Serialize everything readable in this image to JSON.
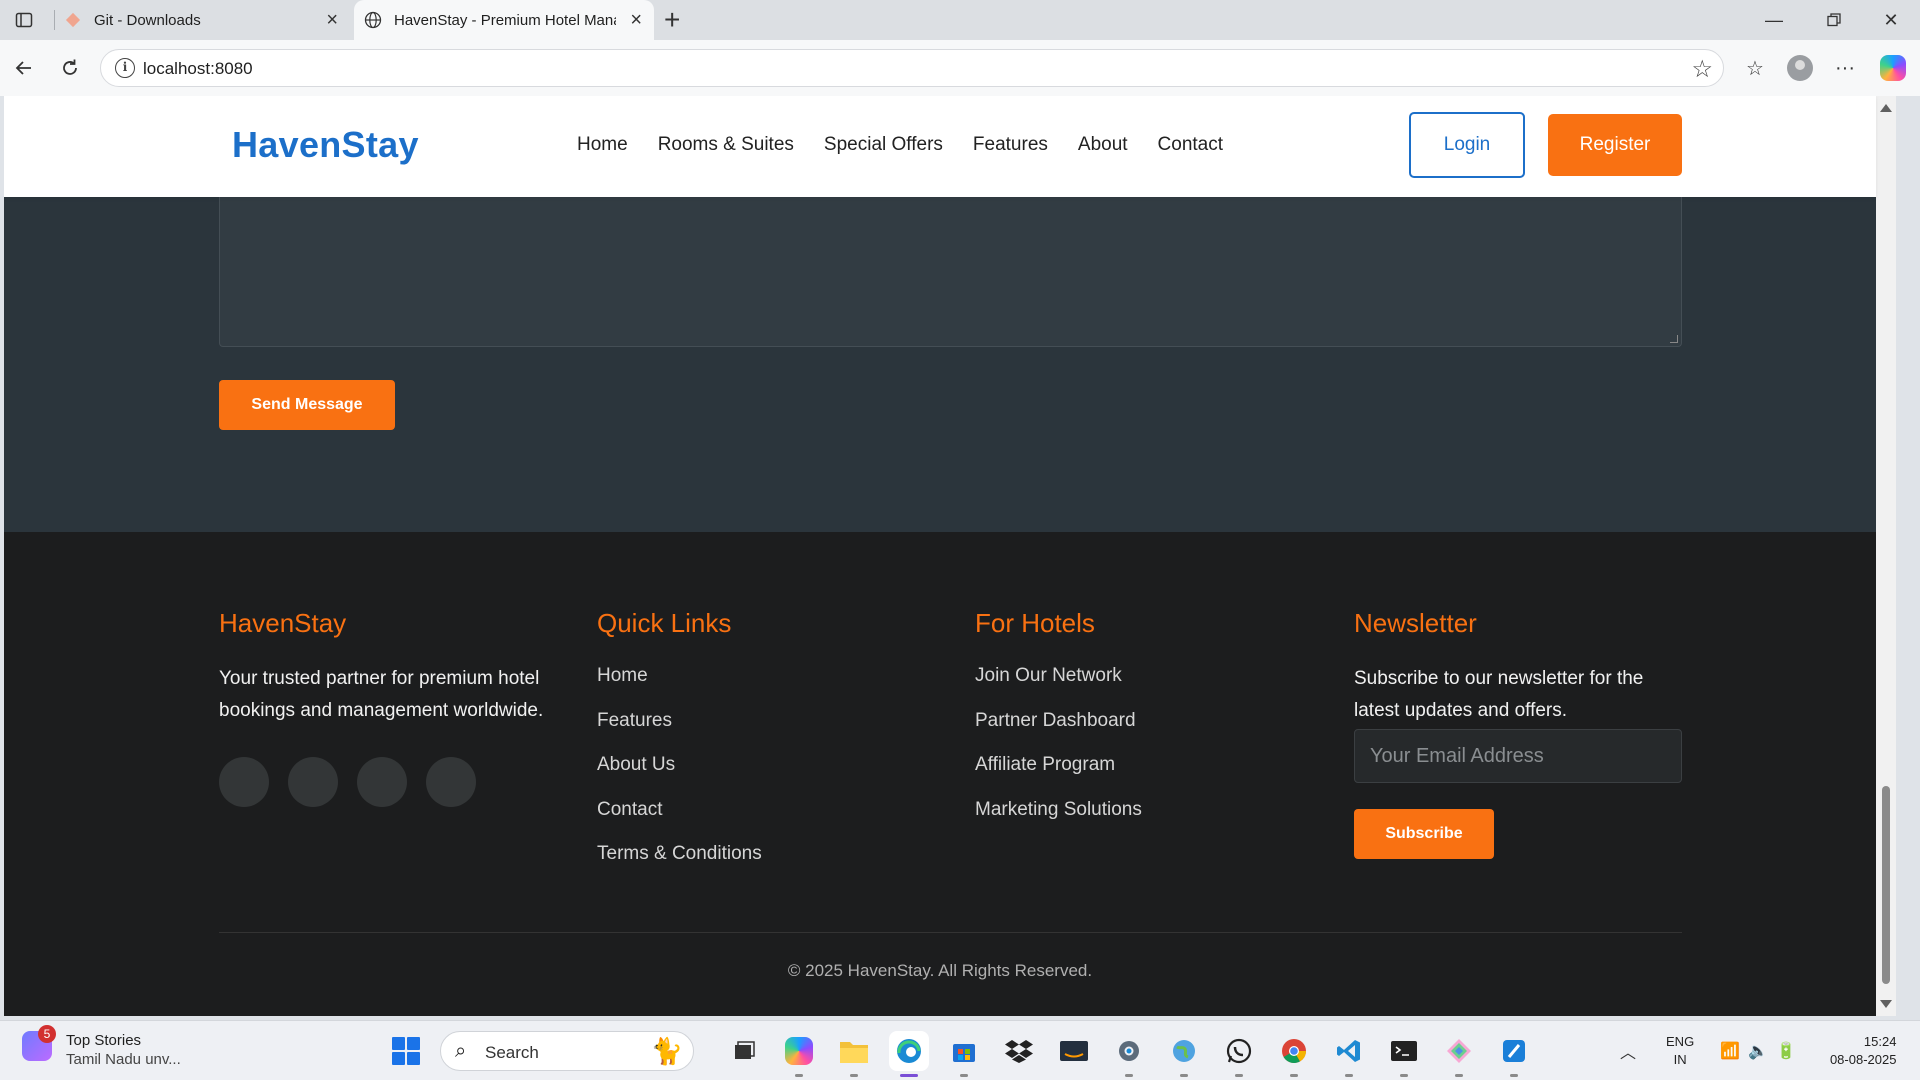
{
  "browser": {
    "tabs": [
      {
        "title": "Git - Downloads",
        "favicon": "git-icon",
        "active": false
      },
      {
        "title": "HavenStay - Premium Hotel Mana",
        "favicon": "globe-icon",
        "active": true
      }
    ],
    "url": "localhost:8080"
  },
  "site": {
    "logo": "HavenStay",
    "nav": [
      "Home",
      "Rooms & Suites",
      "Special Offers",
      "Features",
      "About",
      "Contact"
    ],
    "login_label": "Login",
    "register_label": "Register",
    "colors": {
      "primary": "#1c6fc9",
      "accent": "#f97112",
      "contact_bg": "#2b353c",
      "footer_bg": "#1c1d1e"
    }
  },
  "contact": {
    "send_label": "Send Message"
  },
  "footer": {
    "brand": {
      "title": "HavenStay",
      "text": "Your trusted partner for premium hotel bookings and management worldwide."
    },
    "quick_links": {
      "title": "Quick Links",
      "items": [
        "Home",
        "Features",
        "About Us",
        "Contact",
        "Terms & Conditions"
      ]
    },
    "for_hotels": {
      "title": "For Hotels",
      "items": [
        "Join Our Network",
        "Partner Dashboard",
        "Affiliate Program",
        "Marketing Solutions"
      ]
    },
    "newsletter": {
      "title": "Newsletter",
      "text": "Subscribe to our newsletter for the latest updates and offers.",
      "placeholder": "Your Email Address",
      "button": "Subscribe"
    },
    "copyright": "© 2025 HavenStay. All Rights Reserved."
  },
  "taskbar": {
    "news_badge": "5",
    "news_title": "Top Stories",
    "news_subtitle": "Tamil Nadu unv...",
    "search_label": "Search",
    "lang_line1": "ENG",
    "lang_line2": "IN",
    "time": "15:24",
    "date": "08-08-2025"
  }
}
